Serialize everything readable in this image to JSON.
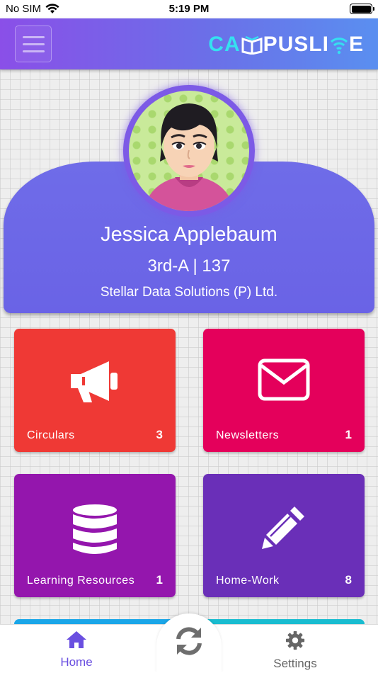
{
  "status_bar": {
    "carrier": "No SIM",
    "time": "5:19 PM"
  },
  "header": {
    "brand_part1": "CA",
    "brand_part2": "PUSLI",
    "brand_part3": "E",
    "brand_full": "CAMPUSLIVE"
  },
  "profile": {
    "name": "Jessica Applebaum",
    "class_roll": "3rd-A | 137",
    "school": "Stellar Data Solutions (P) Ltd."
  },
  "tiles": [
    {
      "label": "Circulars",
      "count": "3",
      "color": "#ef3935",
      "icon": "megaphone-icon"
    },
    {
      "label": "Newsletters",
      "count": "1",
      "color": "#e4005b",
      "icon": "envelope-icon"
    },
    {
      "label": "Learning Resources",
      "count": "1",
      "color": "#9416ad",
      "icon": "database-icon"
    },
    {
      "label": "Home-Work",
      "count": "8",
      "color": "#6a2fb8",
      "icon": "pencil-icon"
    }
  ],
  "peek_tiles": [
    {
      "color": "#1aa6e8"
    },
    {
      "color": "#19bcd0"
    }
  ],
  "tab_bar": {
    "home_label": "Home",
    "settings_label": "Settings",
    "active_color": "#6a4fe0",
    "inactive_color": "#666666"
  }
}
